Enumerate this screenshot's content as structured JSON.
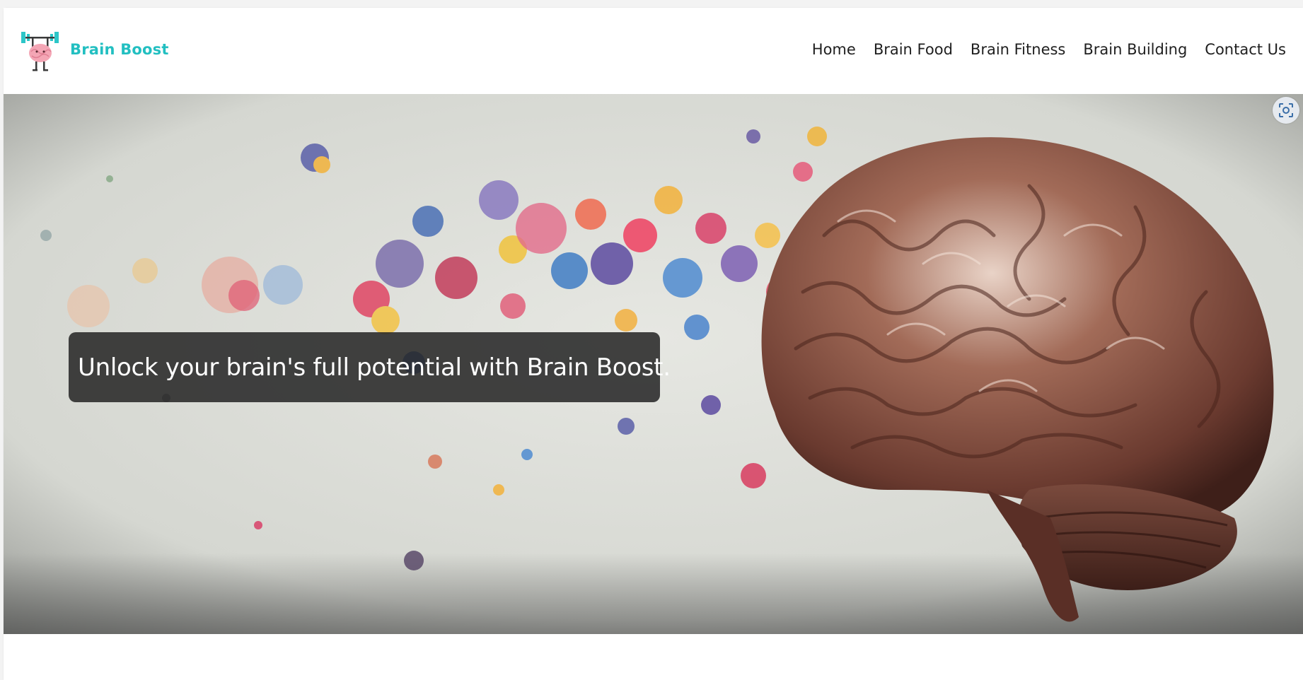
{
  "brand": {
    "name": "Brain Boost",
    "logo_icon": "dumbbell-brain-logo-icon",
    "color": "#22bfc1"
  },
  "nav": {
    "items": [
      {
        "label": "Home"
      },
      {
        "label": "Brain Food"
      },
      {
        "label": "Brain Fitness"
      },
      {
        "label": "Brain Building"
      },
      {
        "label": "Contact Us"
      }
    ]
  },
  "hero": {
    "tagline": "Unlock your brain's full potential with Brain Boost.",
    "image": "brain-with-color-splash-image",
    "lens_icon": "visual-search-icon"
  }
}
